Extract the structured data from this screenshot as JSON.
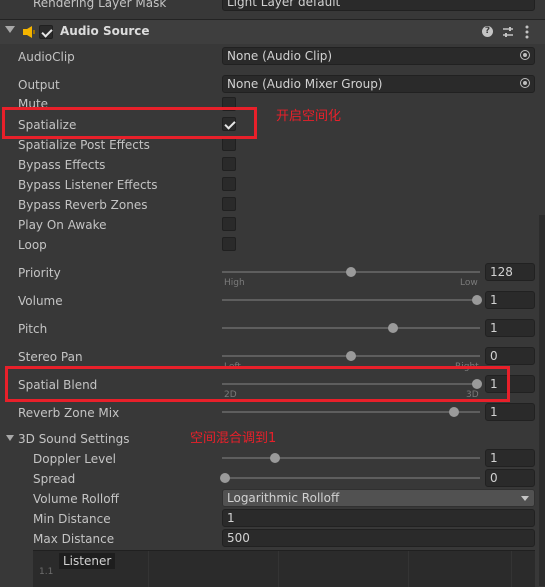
{
  "top_row": {
    "label": "Rendering Layer Mask",
    "value": "Light Layer default"
  },
  "component": {
    "title": "Audio Source"
  },
  "props": {
    "audioclip": {
      "label": "AudioClip",
      "value": "None (Audio Clip)"
    },
    "output": {
      "label": "Output",
      "value": "None (Audio Mixer Group)"
    },
    "mute": {
      "label": "Mute",
      "checked": false
    },
    "spatialize": {
      "label": "Spatialize",
      "checked": true
    },
    "spatialize_post": {
      "label": "Spatialize Post Effects",
      "checked": false
    },
    "bypass_effects": {
      "label": "Bypass Effects",
      "checked": false
    },
    "bypass_listener": {
      "label": "Bypass Listener Effects",
      "checked": false
    },
    "bypass_reverb": {
      "label": "Bypass Reverb Zones",
      "checked": false
    },
    "play_on_awake": {
      "label": "Play On Awake",
      "checked": false
    },
    "loop": {
      "label": "Loop",
      "checked": false
    },
    "priority": {
      "label": "Priority",
      "value": "128",
      "fraction": 0.5,
      "tick_left": "High",
      "tick_right": "Low"
    },
    "volume": {
      "label": "Volume",
      "value": "1",
      "fraction": 1
    },
    "pitch": {
      "label": "Pitch",
      "value": "1",
      "fraction": 0.667
    },
    "stereo_pan": {
      "label": "Stereo Pan",
      "value": "0",
      "fraction": 0.5,
      "tick_left": "Left",
      "tick_right": "Right"
    },
    "spatial_blend": {
      "label": "Spatial Blend",
      "value": "1",
      "fraction": 1,
      "tick_left": "2D",
      "tick_right": "3D"
    },
    "reverb_zone_mix": {
      "label": "Reverb Zone Mix",
      "value": "1",
      "fraction": 0.909
    }
  },
  "sound3d": {
    "label": "3D Sound Settings",
    "doppler": {
      "label": "Doppler Level",
      "value": "1",
      "fraction": 0.2
    },
    "spread": {
      "label": "Spread",
      "value": "0",
      "fraction": 0
    },
    "rolloff": {
      "label": "Volume Rolloff",
      "value": "Logarithmic Rolloff"
    },
    "min_distance": {
      "label": "Min Distance",
      "value": "1"
    },
    "max_distance": {
      "label": "Max Distance",
      "value": "500"
    },
    "graph": {
      "legend": "Listener",
      "y_label": "1.1"
    }
  },
  "annotations": {
    "spatialize_note": "开启空间化",
    "blend_note": "空间混合调到1"
  },
  "colors": {
    "annotation": "#e8202a",
    "panel": "#383838",
    "field": "#2a2a2a"
  }
}
